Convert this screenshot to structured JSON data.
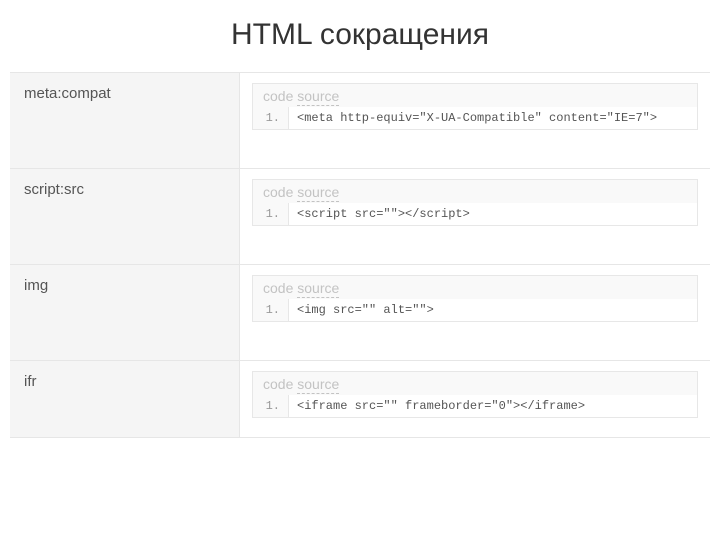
{
  "header": {
    "title": "HTML сокращения"
  },
  "codeHeader": {
    "code": "code",
    "source": "source"
  },
  "rows": [
    {
      "label": "meta:compat",
      "lineNo": "1.",
      "code": "<meta http-equiv=\"X-UA-Compatible\" content=\"IE=7\">"
    },
    {
      "label": "script:src",
      "lineNo": "1.",
      "code": "<script src=\"\"></script>"
    },
    {
      "label": "img",
      "lineNo": "1.",
      "code": "<img src=\"\" alt=\"\">"
    },
    {
      "label": "ifr",
      "lineNo": "1.",
      "code": "<iframe src=\"\" frameborder=\"0\"></iframe>"
    }
  ]
}
